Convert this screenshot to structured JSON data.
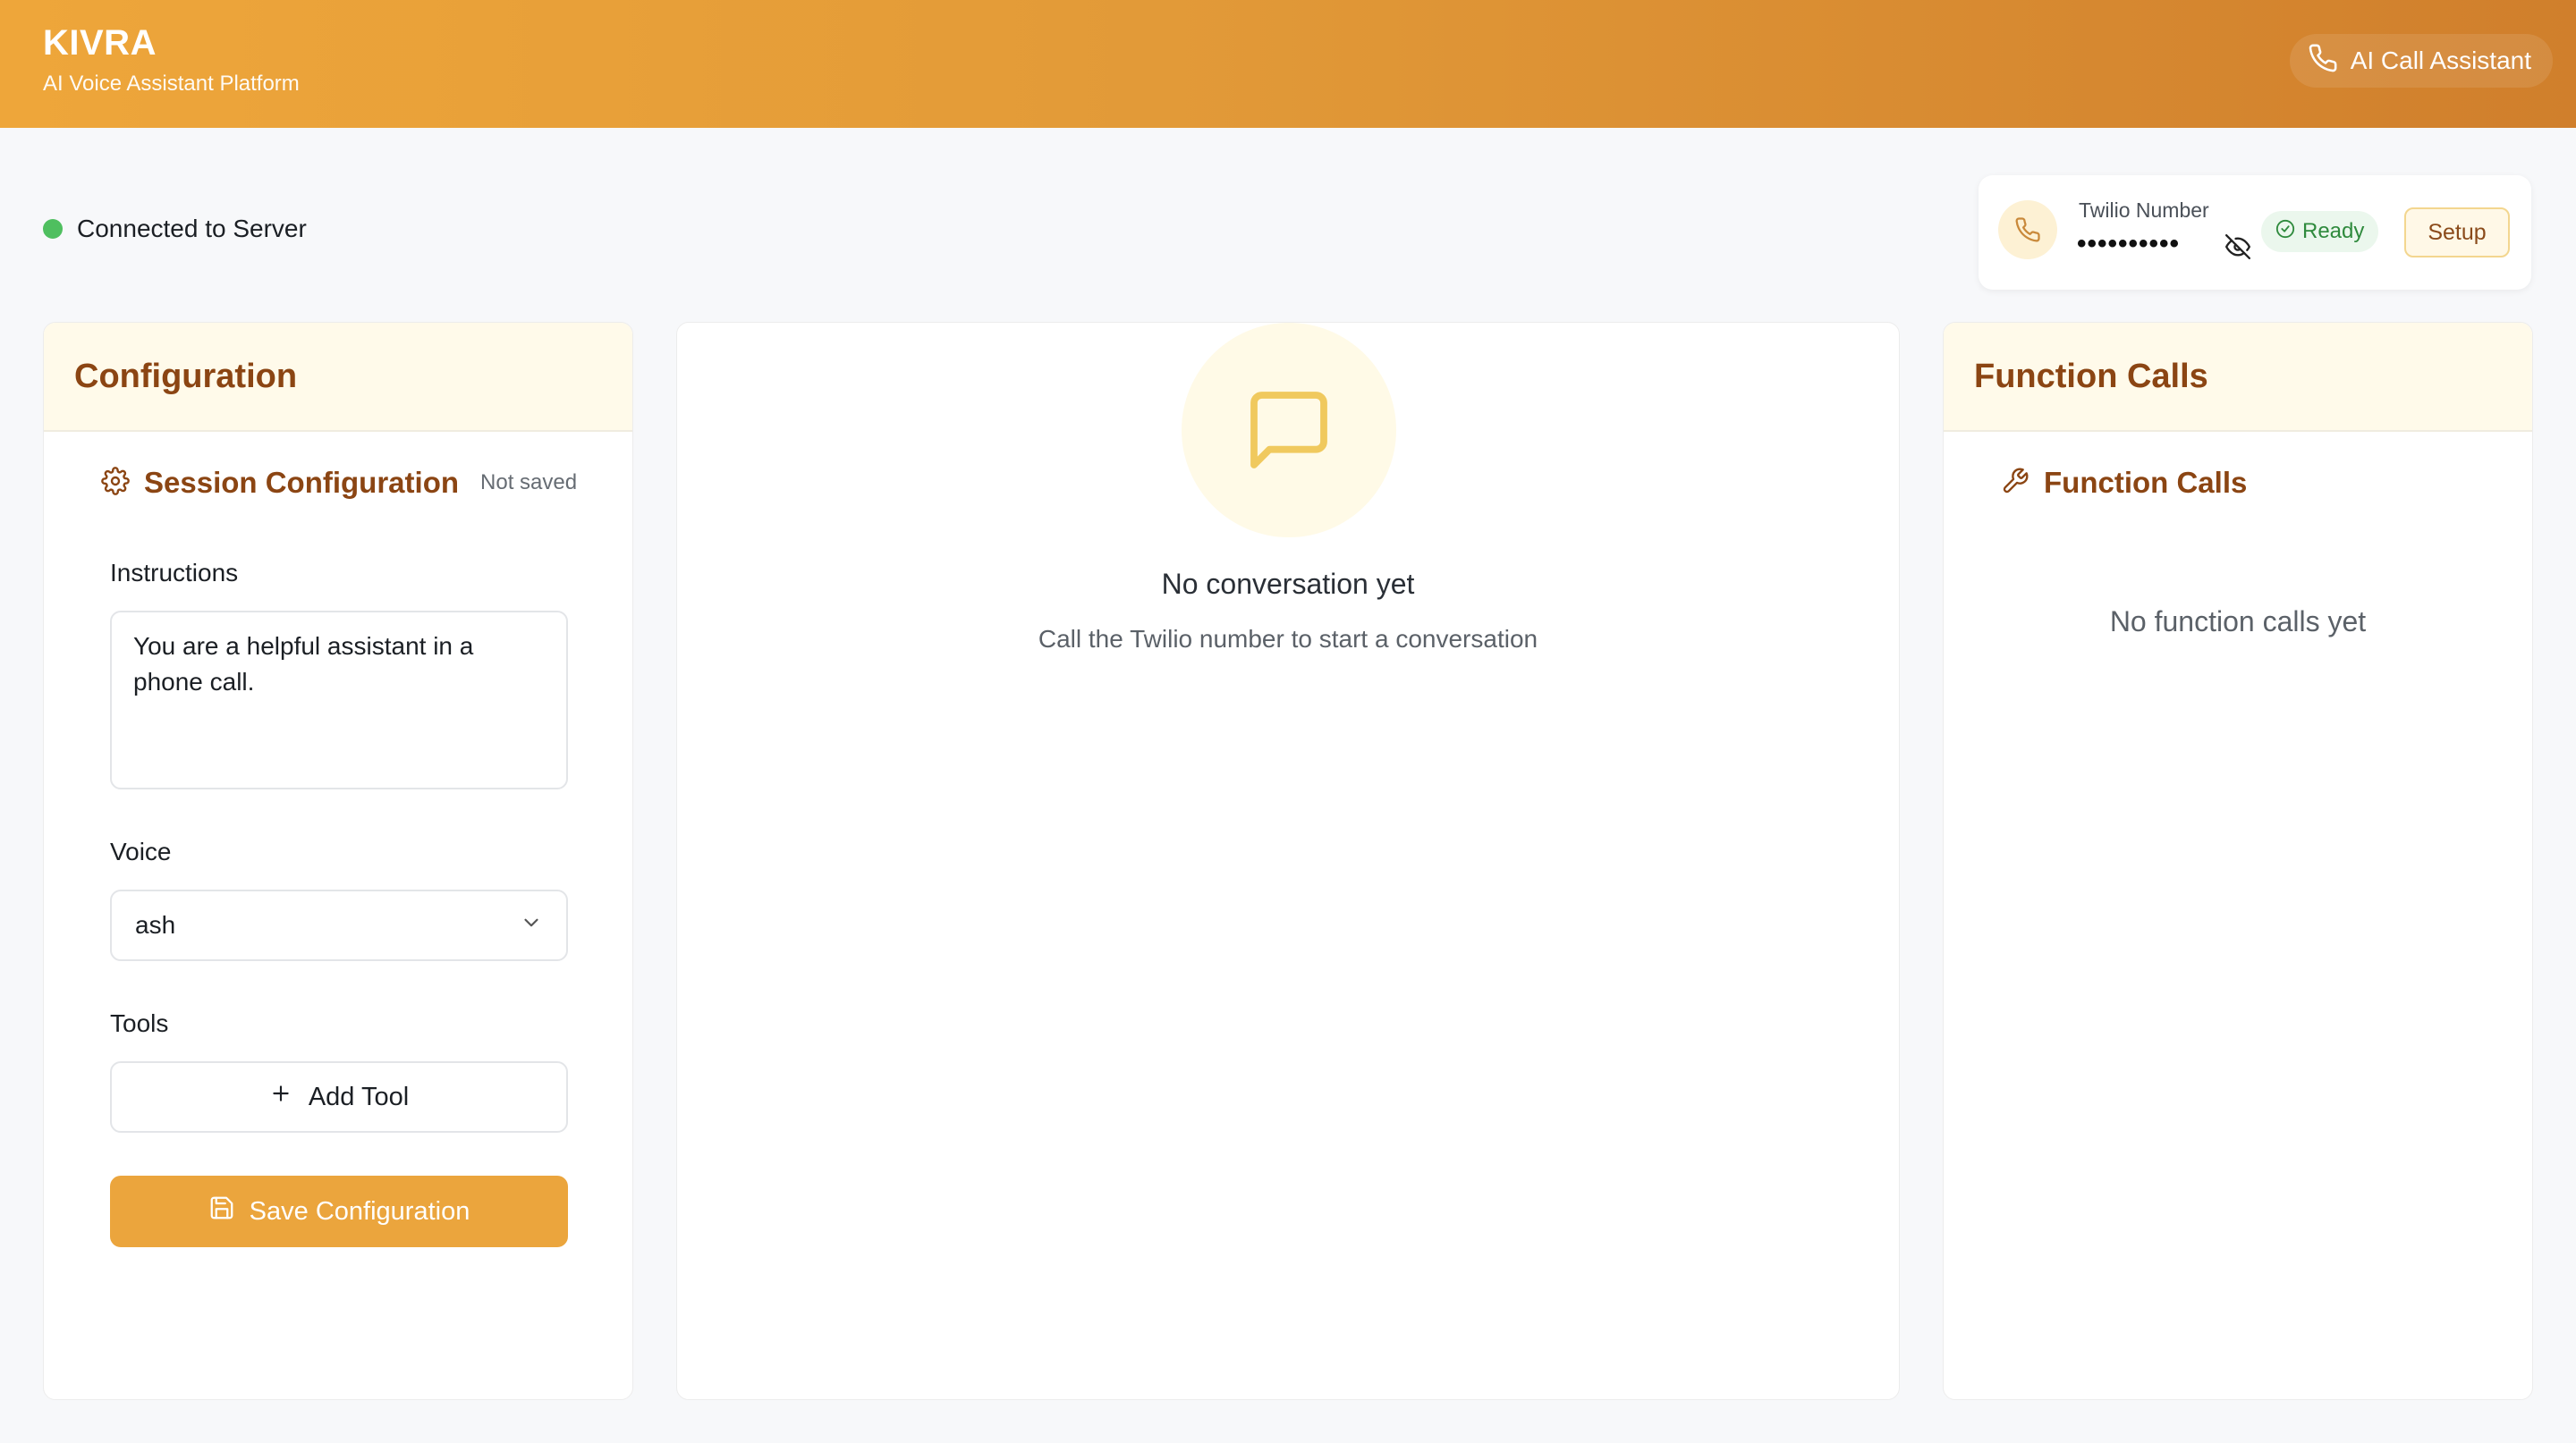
{
  "header": {
    "brand": "KIVRA",
    "subtitle": "AI Voice Assistant Platform",
    "assistant_label": "AI Call Assistant"
  },
  "status": {
    "text": "Connected to Server",
    "color": "#4fbf5f"
  },
  "twilio": {
    "label": "Twilio Number",
    "value": "••••••••••",
    "status": "Ready",
    "setup_label": "Setup"
  },
  "configuration": {
    "panel_title": "Configuration",
    "section_title": "Session Configuration",
    "save_state": "Not saved",
    "instructions_label": "Instructions",
    "instructions_value": "You are a helpful assistant in a phone call.",
    "voice_label": "Voice",
    "voice_value": "ash",
    "tools_label": "Tools",
    "add_tool_label": "Add Tool",
    "save_label": "Save Configuration"
  },
  "conversation": {
    "empty_title": "No conversation yet",
    "empty_subtitle": "Call the Twilio number to start a conversation"
  },
  "function_calls": {
    "panel_title": "Function Calls",
    "section_title": "Function Calls",
    "empty_text": "No function calls yet"
  },
  "colors": {
    "accent": "#eba53d",
    "brown": "#8b4513",
    "header_start": "#eea63a",
    "header_end": "#d07f2c"
  },
  "icons": [
    "phone-icon",
    "gear-icon",
    "eye-off-icon",
    "check-circle-icon",
    "chevron-down-icon",
    "plus-icon",
    "save-icon",
    "message-square-icon",
    "wrench-icon"
  ]
}
